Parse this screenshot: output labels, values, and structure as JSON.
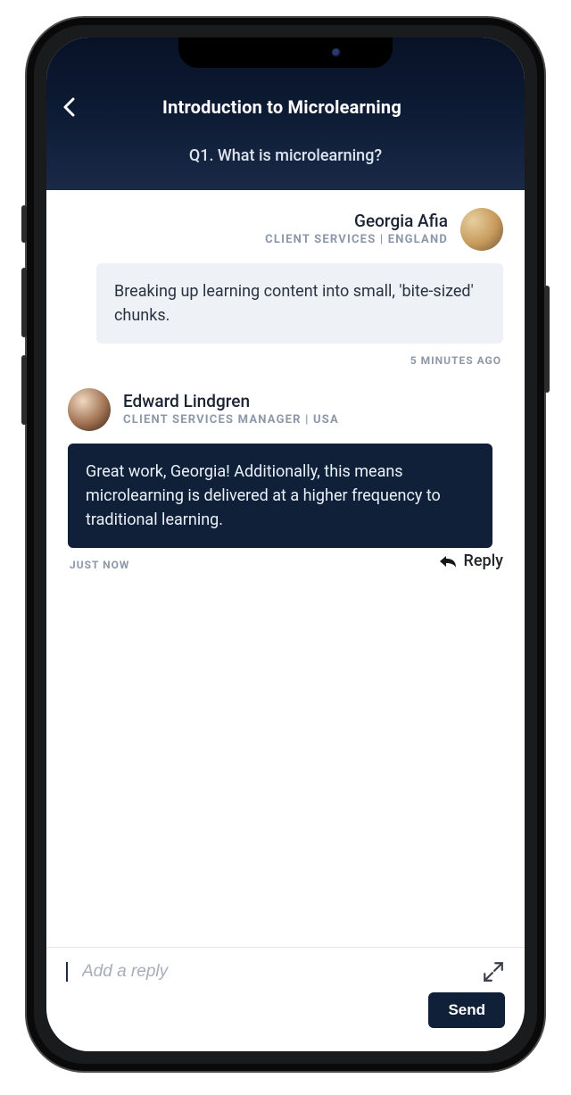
{
  "header": {
    "title": "Introduction to Microlearning",
    "subtitle": "Q1. What is microlearning?"
  },
  "messages": [
    {
      "name": "Georgia Afia",
      "role": "CLIENT SERVICES  |  ENGLAND",
      "body": "Breaking up learning content into small, 'bite-sized' chunks.",
      "timestamp": "5 MINUTES AGO",
      "side": "right",
      "tone": "light"
    },
    {
      "name": "Edward Lindgren",
      "role": "CLIENT SERVICES MANAGER  |  USA",
      "body": "Great work, Georgia! Additionally, this means microlearning is delivered at a higher frequency to traditional learning.",
      "timestamp": "JUST NOW",
      "side": "left",
      "tone": "dark"
    }
  ],
  "reply_label": "Reply",
  "composer": {
    "placeholder": "Add a reply",
    "send_label": "Send"
  },
  "icons": {
    "back": "chevron-left-icon",
    "reply": "reply-arrow-icon",
    "expand": "expand-icon"
  }
}
